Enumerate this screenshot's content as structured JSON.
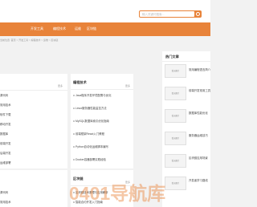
{
  "search": {
    "placeholder": "输入关键词搜索..."
  },
  "nav": {
    "items": [
      "开发工具",
      "编程技术",
      "运维",
      "区块链"
    ]
  },
  "breadcrumb": "当前位置: 首页 > 开发工具 > 编程技术 > 运维 > 区块链",
  "left_panel": {
    "more": "更多",
    "rows": [
      "源代码",
      "常用技术",
      "软件下载",
      "移动开发",
      "数据库",
      "前端开发",
      "后端开发",
      "运维部署"
    ]
  },
  "tech_panel": {
    "title": "编程技术",
    "more": "更多",
    "rows": [
      "Java程序开发环境配置与优化",
      "Linux服务器性能监控方法",
      "MySQL数据库索引优化指南",
      "前端框架React入门教程",
      "Python自动化运维脚本编写",
      "Docker容器部署实践经验"
    ]
  },
  "chain_panel": {
    "title": "区块链",
    "more": "更多",
    "rows": [
      "区块链技术原理与应用解析",
      "智能合约开发入门指南"
    ]
  },
  "hot_panel": {
    "title": "热门文章",
    "items": [
      {
        "thumb": "暂无图片",
        "text": "常用编程语言简介"
      },
      {
        "thumb": "暂无图片",
        "text": "前端开发常用工具"
      },
      {
        "thumb": "暂无图片",
        "text": "数据库性能优化"
      },
      {
        "thumb": "暂无图片",
        "text": "服务器运维技巧"
      },
      {
        "thumb": "暂无图片",
        "text": "区块链应用场景"
      },
      {
        "thumb": "暂无图片",
        "text": "开发者学习路线"
      }
    ]
  },
  "watermark": "0401导航库",
  "colors": {
    "accent": "#e8833a",
    "background": "#f2f2f2",
    "card": "#ffffff"
  }
}
